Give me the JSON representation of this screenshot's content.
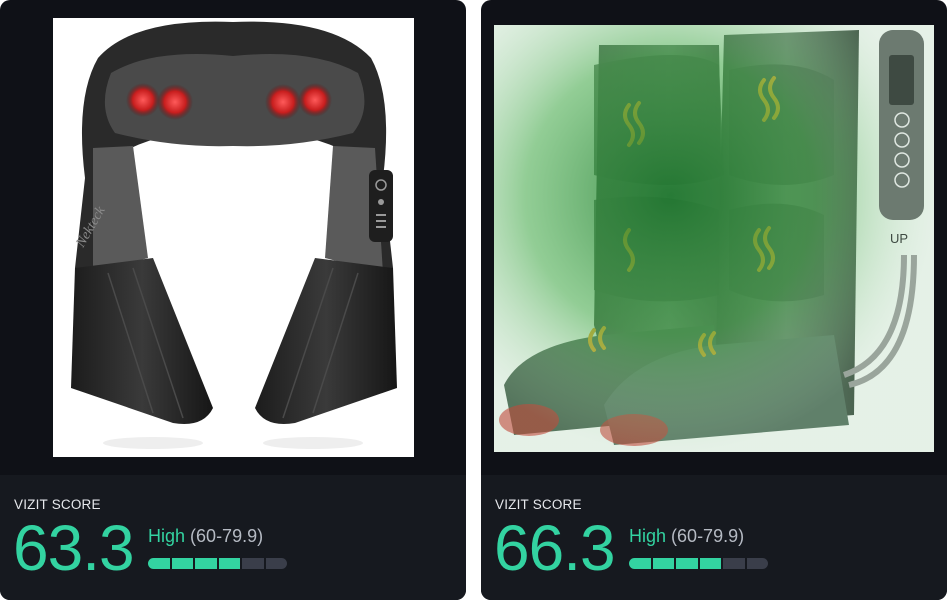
{
  "cards": [
    {
      "label": "VIZIT SCORE",
      "score": "63.3",
      "level": "High",
      "range": "(60-79.9)",
      "bar_fill": 0.66,
      "image_text": "Nekteck"
    },
    {
      "label": "VIZIT SCORE",
      "score": "66.3",
      "level": "High",
      "range": "(60-79.9)",
      "bar_fill": 0.66,
      "image_text": "UP"
    }
  ],
  "colors": {
    "accent": "#33d3a1",
    "card_bg": "#0f1117",
    "panel_bg": "#16191f",
    "bar_empty": "#3a3e4a"
  }
}
